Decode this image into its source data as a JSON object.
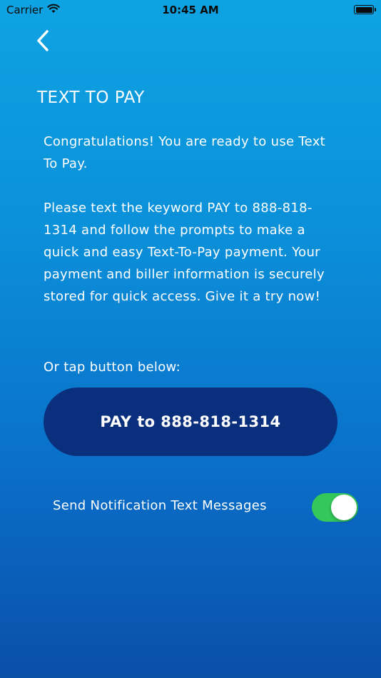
{
  "status_bar": {
    "carrier": "Carrier",
    "time": "10:45 AM"
  },
  "header": {
    "title": "TEXT TO PAY"
  },
  "content": {
    "para1": "Congratulations! You are ready to use Text To Pay.",
    "para2": "Please text the keyword PAY to 888-818-1314 and follow the prompts to make a quick and easy Text-To-Pay payment. Your payment and biller information is securely stored for quick access. Give it a try now!",
    "para3": "Or tap button below:"
  },
  "pay_button": {
    "label": "PAY to 888-818-1314"
  },
  "notifications": {
    "label": "Send Notification Text Messages",
    "enabled": true
  },
  "colors": {
    "button_bg": "#0a2f7d",
    "toggle_on": "#34c759"
  },
  "icons": {
    "wifi": "wifi-icon",
    "battery": "battery-icon",
    "back": "chevron-left-icon"
  }
}
